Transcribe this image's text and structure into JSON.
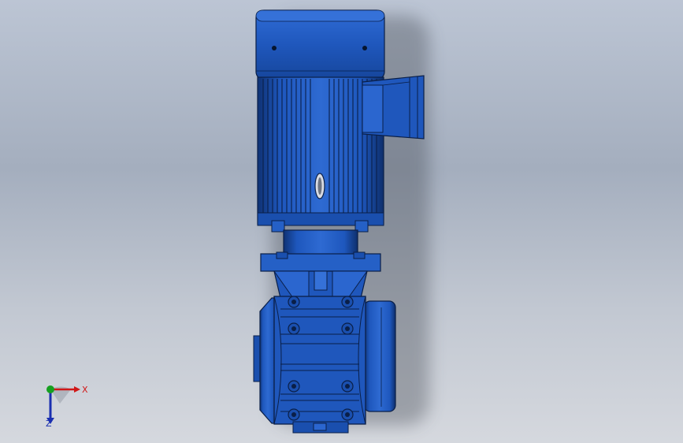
{
  "viewport": {
    "background_top": "#bcc5d4",
    "background_bottom": "#d5d8de",
    "model": {
      "name": "vertical-motor-gearbox",
      "color": "#1f55b5",
      "edge_color": "#0a1f48"
    }
  },
  "triad": {
    "x_label": "X",
    "z_label": "Z",
    "x_color": "#d01818",
    "y_color": "#16a020",
    "z_color": "#1a2fb0"
  }
}
